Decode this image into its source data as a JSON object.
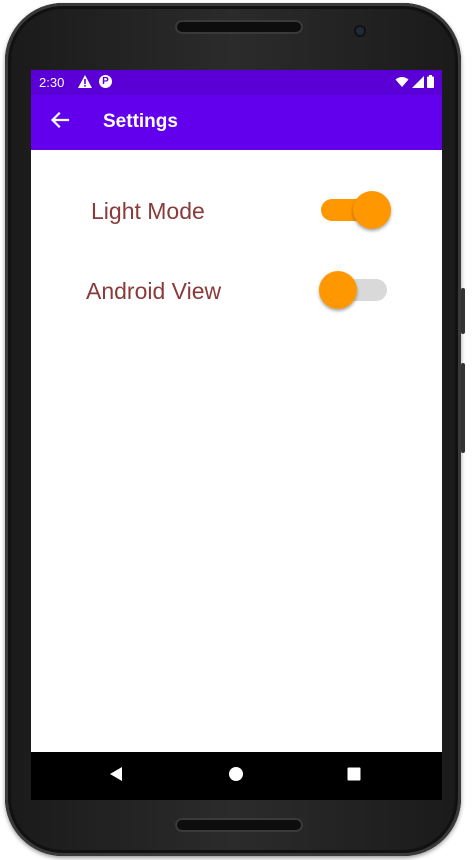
{
  "status_bar": {
    "time": "2:30",
    "icons": [
      "warning-icon",
      "p-notification-icon",
      "wifi-icon",
      "signal-icon",
      "battery-icon"
    ],
    "p_glyph": "P"
  },
  "app_bar": {
    "title": "Settings",
    "back_icon": "arrow-back-icon"
  },
  "settings": [
    {
      "label": "Light Mode",
      "enabled": true
    },
    {
      "label": "Android View",
      "enabled": false
    }
  ],
  "nav_bar": {
    "buttons": [
      "back-triangle-icon",
      "home-circle-icon",
      "recents-square-icon"
    ]
  },
  "colors": {
    "status_bar": "#5a00d6",
    "app_bar": "#6200ee",
    "label_text": "#8b3a3a",
    "switch_thumb": "#ff9800",
    "switch_track_on": "#ff9800",
    "switch_track_off": "#d9d9d9"
  }
}
